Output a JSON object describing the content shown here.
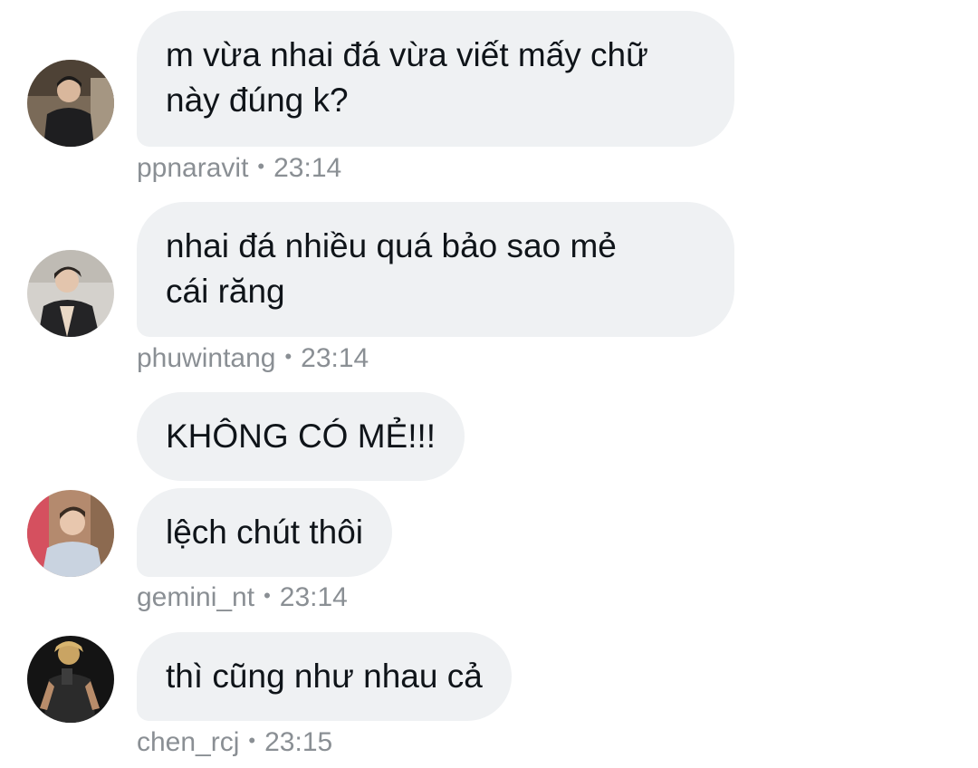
{
  "messages": [
    {
      "text": "m vừa nhai đá vừa viết mấy chữ\nnày đúng k?",
      "user": "ppnaravit",
      "time": "23:14"
    },
    {
      "text": "nhai đá nhiều quá bảo sao mẻ\ncái răng",
      "user": "phuwintang",
      "time": "23:14"
    },
    {
      "text": "KHÔNG CÓ MẺ!!!"
    },
    {
      "text": "lệch chút thôi",
      "user": "gemini_nt",
      "time": "23:14"
    },
    {
      "text": "thì cũng như nhau cả",
      "user": "chen_rcj",
      "time": "23:15"
    }
  ],
  "separator": "•",
  "avatars": [
    "avatar-ppnaravit",
    "avatar-phuwintang",
    "avatar-gemini_nt",
    "avatar-chen_rcj"
  ],
  "colors": {
    "bubble": "#eff1f3",
    "text": "#0f1419",
    "meta": "#8a8f94",
    "background": "#ffffff"
  }
}
